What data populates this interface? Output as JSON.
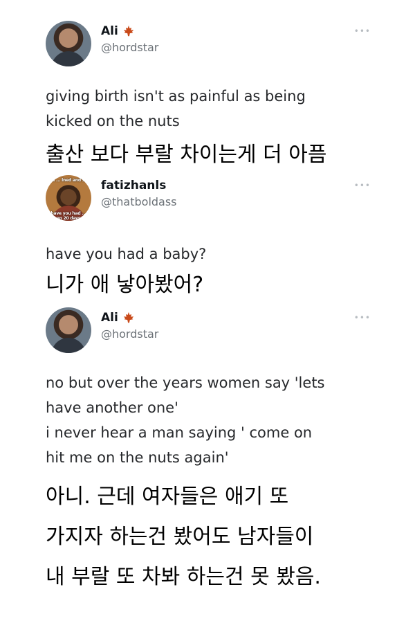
{
  "tweets": [
    {
      "author": {
        "name": "Ali",
        "handle": "@hordstar",
        "badge_icon": "maple-leaf-icon"
      },
      "text": [
        "giving birth isn't as painful as being",
        "kicked on the nuts"
      ],
      "translation": [
        "출산 보다 부랄 차이는게 더 아픔"
      ]
    },
    {
      "author": {
        "name": "fatizhanls",
        "handle": "@thatboldass",
        "avatar_caption_top": "s ​​... lned and s",
        "avatar_caption_bottom": "have you had ... en 20 days"
      },
      "text": [
        "have you had a baby?"
      ],
      "translation": [
        "니가 애 낳아봤어?"
      ]
    },
    {
      "author": {
        "name": "Ali",
        "handle": "@hordstar",
        "badge_icon": "maple-leaf-icon"
      },
      "text": [
        "no but over the years women say 'lets",
        "have another one'",
        "i never hear a man saying ' come on",
        "hit me on the nuts again'"
      ],
      "translation": [
        "아니. 근데 여자들은 애기 또",
        "가지자 하는건 봤어도 남자들이",
        "내 부랄 또 차봐 하는건 못 봤음."
      ]
    }
  ],
  "more_menu_icon": "more-horizontal-icon",
  "colors": {
    "name": "#0f1419",
    "handle": "#6b7177",
    "leaf": "#c94a1a"
  }
}
